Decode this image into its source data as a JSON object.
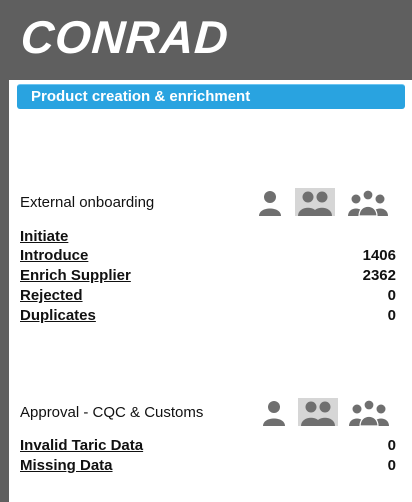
{
  "brand": {
    "logo_text": "CONRAD"
  },
  "header": {
    "title": "Product creation & enrichment"
  },
  "external_onboarding": {
    "title": "External onboarding",
    "icons": [
      "single-user-icon",
      "two-users-icon",
      "user-group-icon"
    ],
    "items": [
      {
        "label": "Initiate",
        "value": ""
      },
      {
        "label": "Introduce",
        "value": "1406"
      },
      {
        "label": "Enrich Supplier",
        "value": "2362"
      },
      {
        "label": "Rejected",
        "value": "0"
      },
      {
        "label": "Duplicates",
        "value": "0"
      }
    ]
  },
  "approval": {
    "title": "Approval - CQC & Customs",
    "icons": [
      "single-user-icon",
      "two-users-icon",
      "user-group-icon"
    ],
    "items": [
      {
        "label": "Invalid Taric Data",
        "value": "0"
      },
      {
        "label": "Missing Data",
        "value": "0"
      }
    ]
  },
  "colors": {
    "header_bg": "#5f5f5f",
    "accent": "#29a3e0",
    "icon": "#6f6f6f"
  }
}
